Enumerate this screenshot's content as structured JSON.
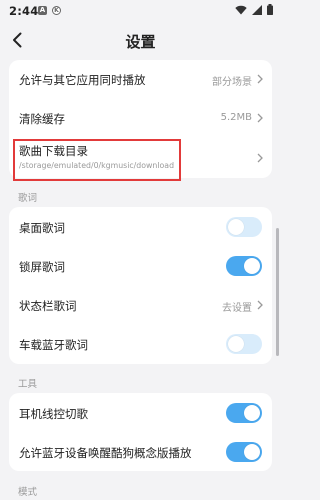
{
  "status_bar": {
    "time": "2:44",
    "notif_a": "A",
    "notif_k": "K"
  },
  "header": {
    "title": "设置"
  },
  "general": {
    "items": [
      {
        "label": "允许与其它应用同时播放",
        "value": "部分场景"
      },
      {
        "label": "清除缓存",
        "value": "5.2MB"
      },
      {
        "label": "歌曲下载目录",
        "sub": "/storage/emulated/0/kgmusic/download"
      }
    ]
  },
  "lyrics": {
    "section_title": "歌词",
    "items": [
      {
        "label": "桌面歌词",
        "toggle": "off"
      },
      {
        "label": "锁屏歌词",
        "toggle": "on"
      },
      {
        "label": "状态栏歌词",
        "value": "去设置"
      },
      {
        "label": "车载蓝牙歌词",
        "toggle": "off"
      }
    ]
  },
  "tools": {
    "section_title": "工具",
    "items": [
      {
        "label": "耳机线控切歌",
        "toggle": "on"
      },
      {
        "label": "允许蓝牙设备唤醒酷狗概念版播放",
        "toggle": "on"
      }
    ]
  },
  "mode": {
    "section_title": "模式"
  },
  "colors": {
    "accent": "#4aa8ef",
    "toggle_off": "#d9ecfb",
    "highlight": "#e23a3a",
    "background": "#f3f3f5"
  }
}
